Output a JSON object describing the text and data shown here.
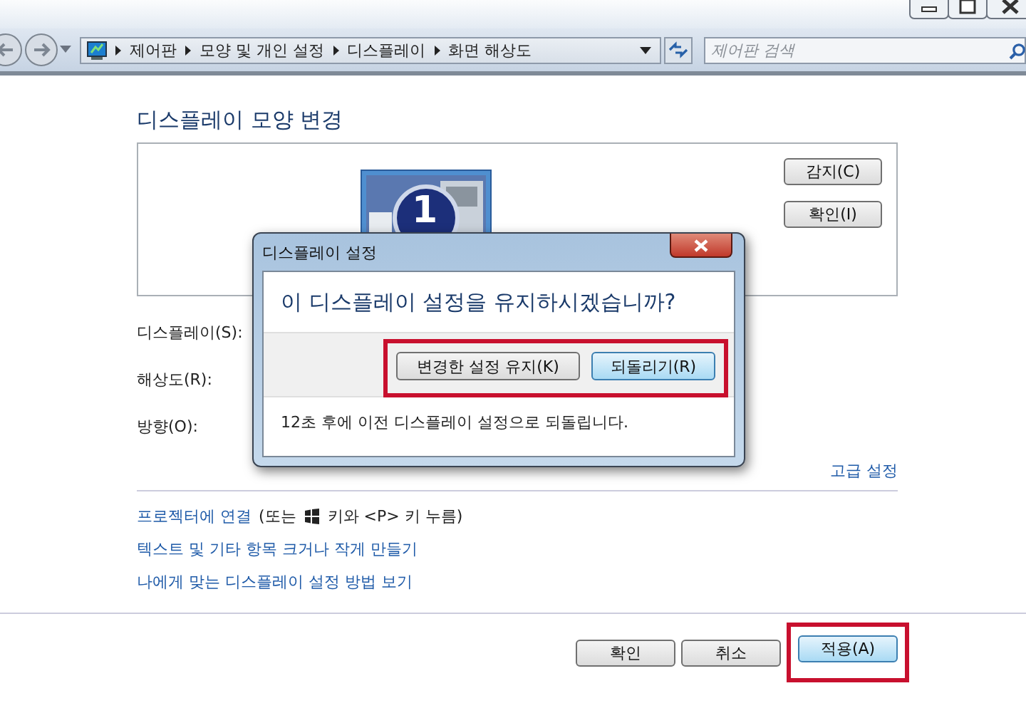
{
  "breadcrumb": [
    "제어판",
    "모양 및 개인 설정",
    "디스플레이",
    "화면 해상도"
  ],
  "search": {
    "placeholder": "제어판 검색"
  },
  "heading": "디스플레이 모양 변경",
  "preview": {
    "monitor_number": "1",
    "buttons": [
      "감지(C)",
      "확인(I)"
    ]
  },
  "fields": [
    {
      "label": "디스플레이(S):"
    },
    {
      "label": "해상도(R):"
    },
    {
      "label": "방향(O):"
    }
  ],
  "advanced_link": "고급 설정",
  "projector": {
    "link": "프로젝터에 연결",
    "note_before": "(또는",
    "note_after": "키와 <P> 키 누름)"
  },
  "links": [
    "텍스트 및 기타 항목 크거나 작게 만들기",
    "나에게 맞는 디스플레이 설정 방법 보기"
  ],
  "footer_buttons": [
    {
      "label": "확인",
      "highlighted": false,
      "focused": false
    },
    {
      "label": "취소",
      "highlighted": false,
      "focused": false
    },
    {
      "label": "적용(A)",
      "highlighted": true,
      "focused": true
    }
  ],
  "dialog": {
    "title": "디스플레이 설정",
    "message": "이 디스플레이 설정을 유지하시겠습니까?",
    "buttons_highlighted": true,
    "buttons": [
      {
        "label": "변경한 설정 유지(K)",
        "focused": false
      },
      {
        "label": "되돌리기(R)",
        "focused": true
      }
    ],
    "countdown": "12초 후에 이전 디스플레이 설정으로 되돌립니다."
  }
}
